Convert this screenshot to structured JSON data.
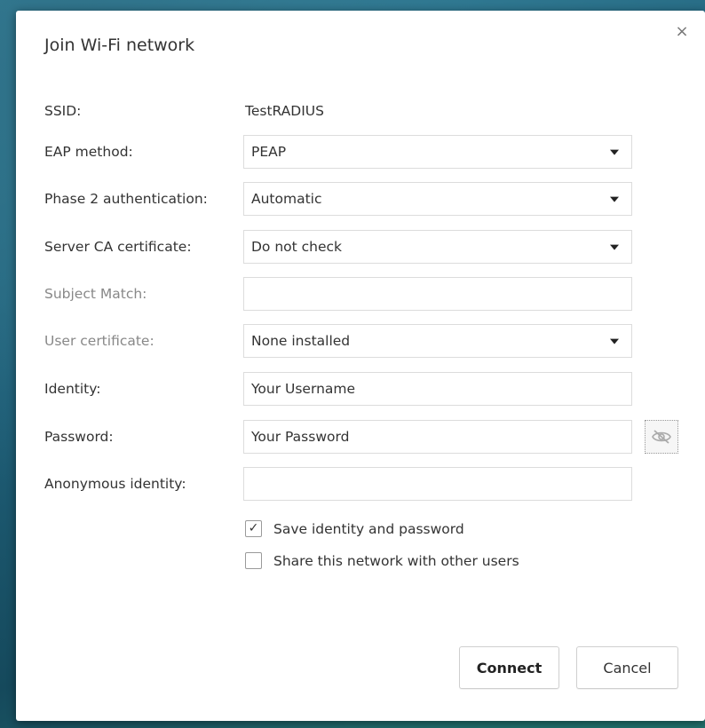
{
  "dialog": {
    "title": "Join Wi-Fi network",
    "close_glyph": "×"
  },
  "fields": {
    "ssid": {
      "label": "SSID:",
      "value": "TestRADIUS"
    },
    "eap_method": {
      "label": "EAP method:",
      "value": "PEAP"
    },
    "phase2": {
      "label": "Phase 2 authentication:",
      "value": "Automatic"
    },
    "server_ca": {
      "label": "Server CA certificate:",
      "value": "Do not check"
    },
    "subject_match": {
      "label": "Subject Match:",
      "value": ""
    },
    "user_cert": {
      "label": "User certificate:",
      "value": "None installed"
    },
    "identity": {
      "label": "Identity:",
      "value": "Your Username"
    },
    "password": {
      "label": "Password:",
      "value": "Your Password"
    },
    "anonymous_identity": {
      "label": "Anonymous identity:",
      "value": ""
    }
  },
  "checkboxes": {
    "save_identity": {
      "label": "Save identity and password",
      "checked": true,
      "mark": "✓"
    },
    "share_network": {
      "label": "Share this network with other users",
      "checked": false,
      "mark": ""
    }
  },
  "buttons": {
    "connect": "Connect",
    "cancel": "Cancel"
  },
  "icons": {
    "close": "close-icon",
    "password_visibility": "eye-off-icon",
    "dropdown": "chevron-down-icon"
  }
}
